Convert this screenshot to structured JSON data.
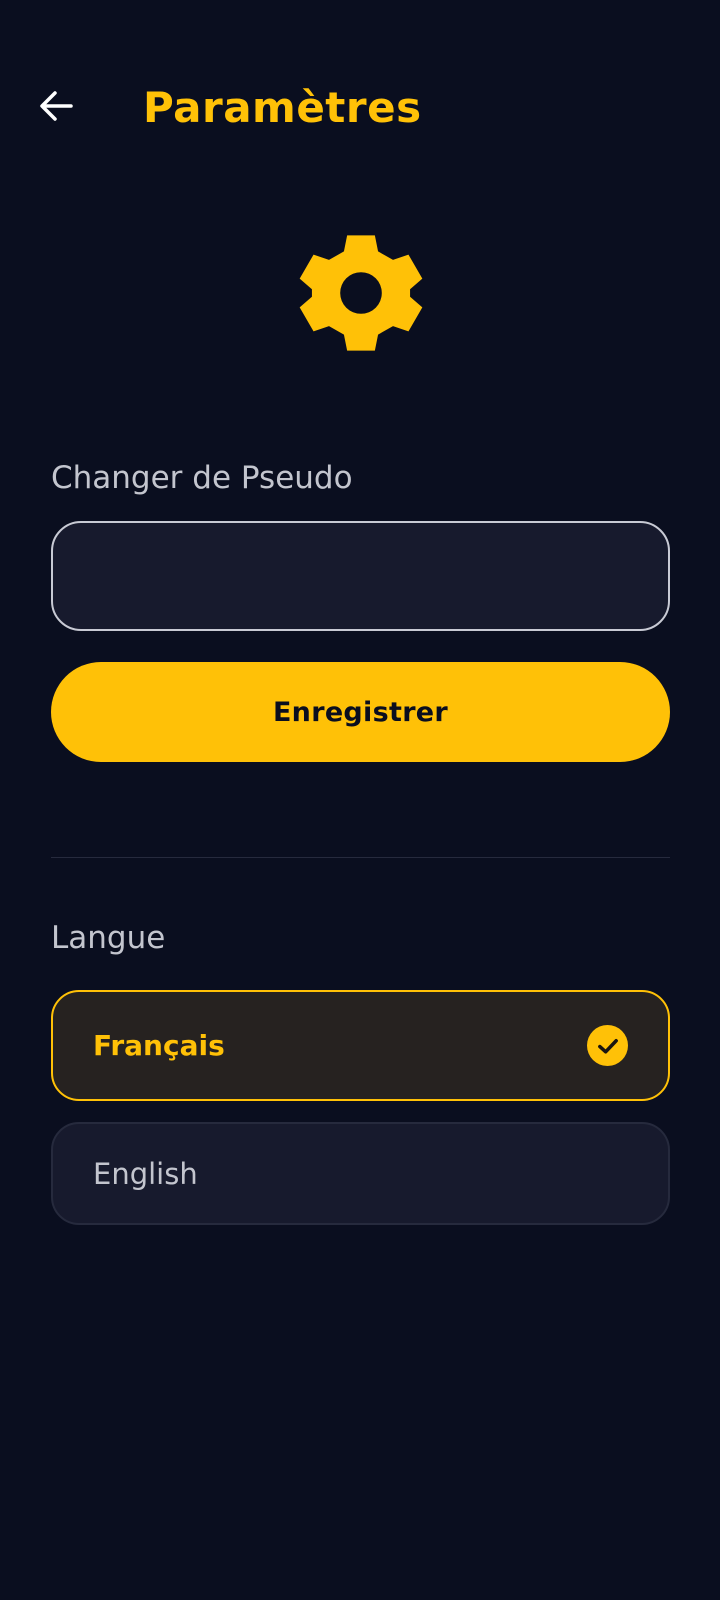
{
  "header": {
    "title": "Paramètres",
    "back_icon": "arrow-left-icon"
  },
  "hero": {
    "icon": "gear-icon"
  },
  "pseudo": {
    "label": "Changer de Pseudo",
    "value": "",
    "placeholder": "",
    "save_label": "Enregistrer"
  },
  "language": {
    "label": "Langue",
    "options": [
      {
        "label": "Français",
        "selected": true
      },
      {
        "label": "English",
        "selected": false
      }
    ],
    "selected_icon": "check-circle-icon"
  },
  "colors": {
    "background": "#0A0E1F",
    "accent": "#FFC107",
    "field": "#171A2D",
    "text_muted": "#C3C5CE"
  }
}
